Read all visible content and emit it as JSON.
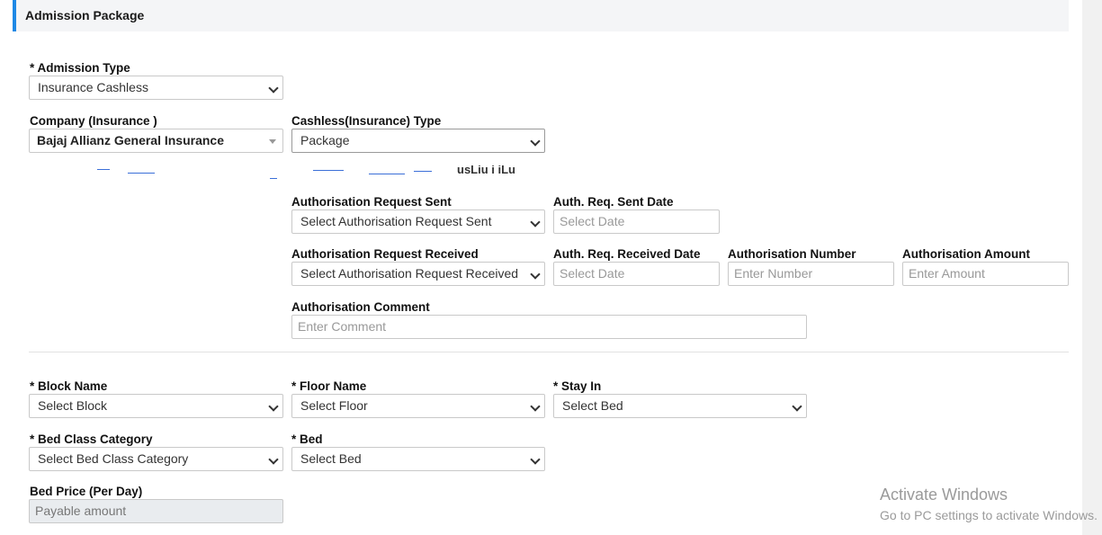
{
  "header": {
    "title": "Admission Package"
  },
  "admission_type": {
    "label": "* Admission Type",
    "value": "Insurance Cashless"
  },
  "company": {
    "label": "Company (Insurance )",
    "value": "Bajaj Allianz General Insurance"
  },
  "cashless_type": {
    "label": "Cashless(Insurance) Type",
    "value": "Package"
  },
  "garbled_text": "usLiu i iLu",
  "auth_sent": {
    "label": "Authorisation Request Sent",
    "value": "Select Authorisation Request Sent"
  },
  "auth_sent_date": {
    "label": "Auth. Req. Sent Date",
    "placeholder": "Select Date"
  },
  "auth_received": {
    "label": "Authorisation Request Received",
    "value": "Select Authorisation Request Received"
  },
  "auth_received_date": {
    "label": "Auth. Req. Received Date",
    "placeholder": "Select Date"
  },
  "auth_number": {
    "label": "Authorisation Number",
    "placeholder": "Enter Number"
  },
  "auth_amount": {
    "label": "Authorisation Amount",
    "placeholder": "Enter Amount"
  },
  "auth_comment": {
    "label": "Authorisation Comment",
    "placeholder": "Enter Comment"
  },
  "block": {
    "label": "* Block Name",
    "value": "Select Block"
  },
  "floor": {
    "label": "* Floor Name",
    "value": "Select Floor"
  },
  "stay_in": {
    "label": "* Stay In",
    "value": "Select Bed"
  },
  "bed_class": {
    "label": "* Bed Class Category",
    "value": "Select Bed Class Category"
  },
  "bed": {
    "label": "* Bed",
    "value": "Select Bed"
  },
  "bed_price": {
    "label": "Bed Price (Per Day)",
    "placeholder": "Payable amount"
  },
  "watermark": {
    "title": "Activate Windows",
    "subtitle": "Go to PC settings to activate Windows."
  },
  "colors": {
    "accent": "#1e88e5",
    "header_bg": "#f4f5f7",
    "border": "#c9c9c9",
    "disabled_bg": "#e9ecef"
  }
}
